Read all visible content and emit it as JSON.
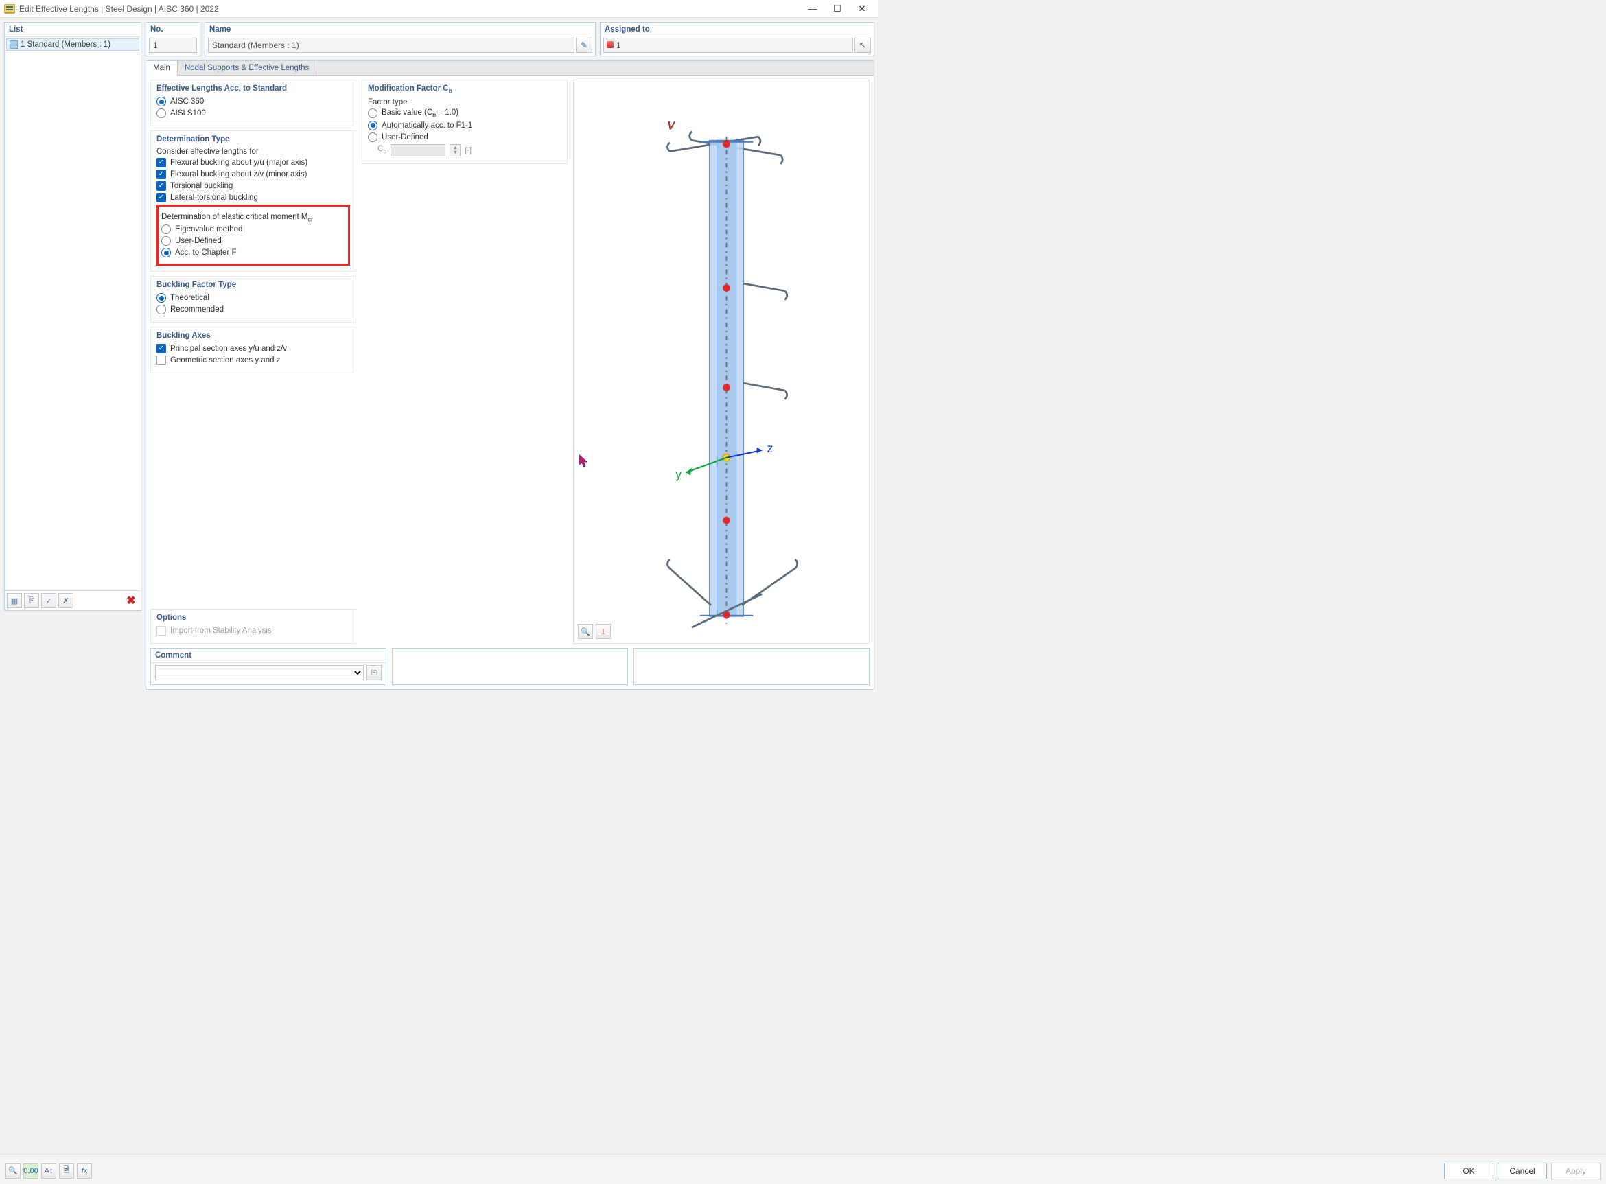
{
  "window": {
    "title": "Edit Effective Lengths | Steel Design | AISC 360 | 2022",
    "min": "—",
    "max": "☐",
    "close": "✕"
  },
  "list": {
    "header": "List",
    "item1": "1 Standard (Members : 1)"
  },
  "fields": {
    "no_label": "No.",
    "no_value": "1",
    "name_label": "Name",
    "name_value": "Standard (Members : 1)",
    "assigned_label": "Assigned to",
    "assigned_value": "1"
  },
  "tabs": {
    "main": "Main",
    "nodal": "Nodal Supports & Effective Lengths"
  },
  "sections": {
    "eff_lengths": {
      "title": "Effective Lengths Acc. to Standard",
      "aisc360": "AISC 360",
      "aisi": "AISI S100"
    },
    "det_type": {
      "title": "Determination Type",
      "consider": "Consider effective lengths for",
      "fbu_major": "Flexural buckling about y/u (major axis)",
      "fbu_minor": "Flexural buckling about z/v (minor axis)",
      "tor": "Torsional buckling",
      "ltb": "Lateral-torsional buckling",
      "mcr_label": "Determination of elastic critical moment M",
      "mcr_sub": "cr",
      "eigen": "Eigenvalue method",
      "user": "User-Defined",
      "chapf": "Acc. to Chapter F"
    },
    "bfactor": {
      "title": "Buckling Factor Type",
      "theor": "Theoretical",
      "recom": "Recommended"
    },
    "baxes": {
      "title": "Buckling Axes",
      "principal": "Principal section axes y/u and z/v",
      "geometric": "Geometric section axes y and z"
    },
    "options": {
      "title": "Options",
      "import_stab": "Import from Stability Analysis"
    },
    "modcb": {
      "title": "Modification Factor C",
      "title_sub": "b",
      "ftype": "Factor type",
      "basic": "Basic value (C",
      "basic_sub": "b",
      "basic2": " = 1.0)",
      "auto": "Automatically acc. to F1-1",
      "user": "User-Defined",
      "cb_label": "C",
      "cb_sub": "b",
      "unit": "[-]"
    },
    "comment": {
      "title": "Comment"
    }
  },
  "footer": {
    "ok": "OK",
    "cancel": "Cancel",
    "apply": "Apply"
  }
}
